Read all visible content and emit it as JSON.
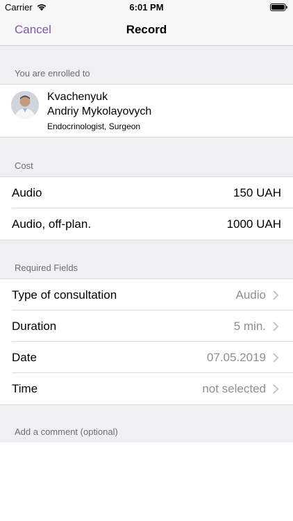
{
  "status_bar": {
    "carrier": "Carrier",
    "time": "6:01 PM"
  },
  "nav": {
    "cancel_label": "Cancel",
    "title": "Record",
    "accent_color": "#7e57a8"
  },
  "enrolled": {
    "header": "You are enrolled to",
    "doctor": {
      "last_name": "Kvachenyuk",
      "first_names": "Andriy Mykolayovych",
      "specialty": "Endocrinologist, Surgeon"
    }
  },
  "cost": {
    "header": "Cost",
    "items": [
      {
        "label": "Audio",
        "value": "150 UAH"
      },
      {
        "label": "Audio, off-plan.",
        "value": "1000 UAH"
      }
    ]
  },
  "required": {
    "header": "Required Fields",
    "fields": [
      {
        "label": "Type of consultation",
        "value": "Audio"
      },
      {
        "label": "Duration",
        "value": "5 min."
      },
      {
        "label": "Date",
        "value": "07.05.2019"
      },
      {
        "label": "Time",
        "value": "not selected"
      }
    ]
  },
  "comment": {
    "header": "Add a comment (optional)"
  }
}
